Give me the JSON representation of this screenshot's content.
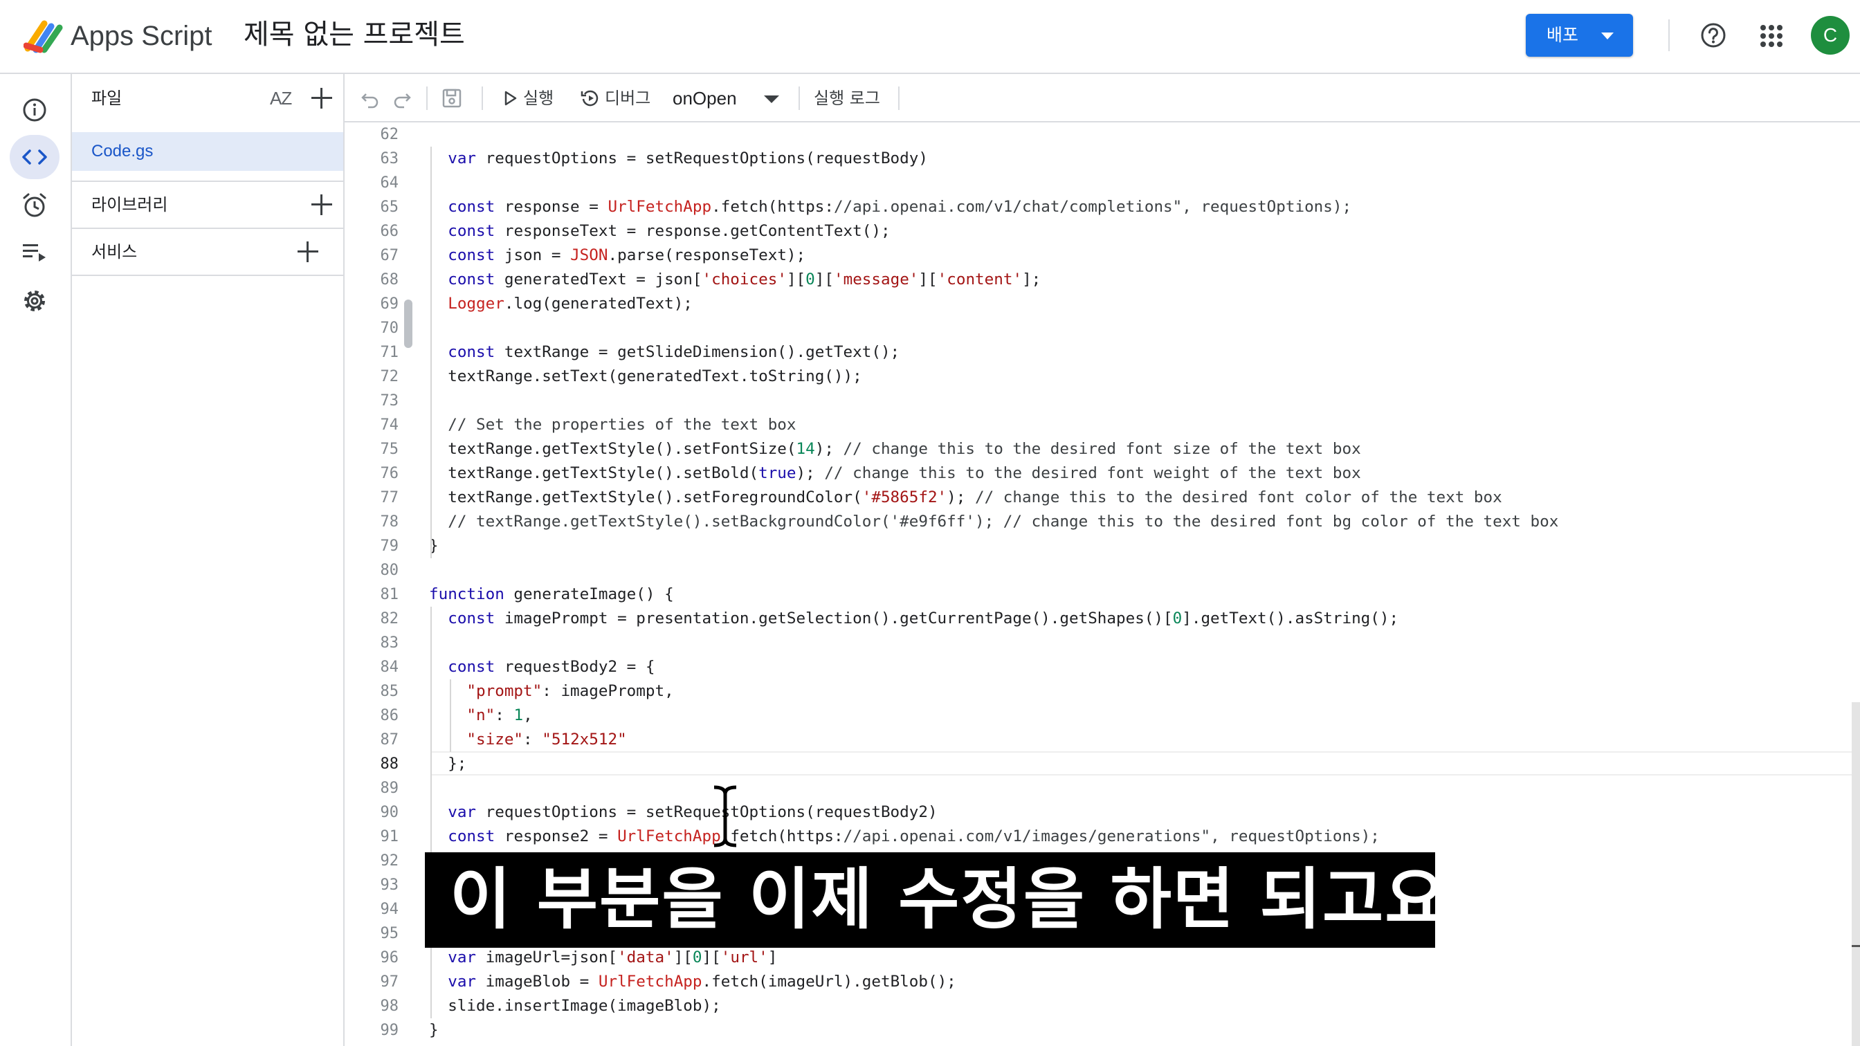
{
  "header": {
    "brand": "Apps Script",
    "project_title": "제목 없는 프로젝트",
    "deploy_label": "배포",
    "avatar_letter": "C"
  },
  "files_panel": {
    "title": "파일",
    "sort_label": "AZ",
    "file_name": "Code.gs",
    "libraries_label": "라이브러리",
    "services_label": "서비스"
  },
  "toolbar": {
    "run_label": "실행",
    "debug_label": "디버그",
    "function_name": "onOpen",
    "log_label": "실행 로그"
  },
  "editor": {
    "current_line": "88",
    "lines": [
      {
        "n": "62",
        "t": ""
      },
      {
        "n": "63",
        "t": "  var requestOptions = setRequestOptions(requestBody)"
      },
      {
        "n": "64",
        "t": ""
      },
      {
        "n": "65",
        "t": "  const response = UrlFetchApp.fetch(\"https://api.openai.com/v1/chat/completions\", requestOptions);"
      },
      {
        "n": "66",
        "t": "  const responseText = response.getContentText();"
      },
      {
        "n": "67",
        "t": "  const json = JSON.parse(responseText);"
      },
      {
        "n": "68",
        "t": "  const generatedText = json['choices'][0]['message']['content'];"
      },
      {
        "n": "69",
        "t": "  Logger.log(generatedText);"
      },
      {
        "n": "70",
        "t": ""
      },
      {
        "n": "71",
        "t": "  const textRange = getSlideDimension().getText();"
      },
      {
        "n": "72",
        "t": "  textRange.setText(generatedText.toString());"
      },
      {
        "n": "73",
        "t": ""
      },
      {
        "n": "74",
        "t": "  // Set the properties of the text box"
      },
      {
        "n": "75",
        "t": "  textRange.getTextStyle().setFontSize(14); // change this to the desired font size of the text box"
      },
      {
        "n": "76",
        "t": "  textRange.getTextStyle().setBold(true); // change this to the desired font weight of the text box"
      },
      {
        "n": "77",
        "t": "  textRange.getTextStyle().setForegroundColor('#5865f2'); // change this to the desired font color of the text box"
      },
      {
        "n": "78",
        "t": "  // textRange.getTextStyle().setBackgroundColor('#e9f6ff'); // change this to the desired font bg color of the text box"
      },
      {
        "n": "79",
        "t": "}"
      },
      {
        "n": "80",
        "t": ""
      },
      {
        "n": "81",
        "t": "function generateImage() {"
      },
      {
        "n": "82",
        "t": "  const imagePrompt = presentation.getSelection().getCurrentPage().getShapes()[0].getText().asString();"
      },
      {
        "n": "83",
        "t": ""
      },
      {
        "n": "84",
        "t": "  const requestBody2 = {"
      },
      {
        "n": "85",
        "t": "    \"prompt\": imagePrompt,"
      },
      {
        "n": "86",
        "t": "    \"n\": 1,"
      },
      {
        "n": "87",
        "t": "    \"size\": \"512x512\""
      },
      {
        "n": "88",
        "t": "  };"
      },
      {
        "n": "89",
        "t": ""
      },
      {
        "n": "90",
        "t": "  var requestOptions = setRequestOptions(requestBody2)"
      },
      {
        "n": "91",
        "t": "  const response2 = UrlFetchApp.fetch(\"https://api.openai.com/v1/images/generations\", requestOptions);"
      },
      {
        "n": "92",
        "t": ""
      },
      {
        "n": "93",
        "t": ""
      },
      {
        "n": "94",
        "t": ""
      },
      {
        "n": "95",
        "t": ""
      },
      {
        "n": "96",
        "t": "  var imageUrl=json['data'][0]['url']"
      },
      {
        "n": "97",
        "t": "  var imageBlob = UrlFetchApp.fetch(imageUrl).getBlob();"
      },
      {
        "n": "98",
        "t": "  slide.insertImage(imageBlob);"
      },
      {
        "n": "99",
        "t": "}"
      }
    ]
  },
  "caption": {
    "text": "이 부분을 이제 수정을 하면 되고요"
  },
  "colors": {
    "accent": "#1a73e8",
    "avatar_bg": "#1e8e3e",
    "active_file_bg": "#e2eaf8",
    "keyword": "#2a00ff",
    "class": "#c5221f",
    "string": "#a31515",
    "number": "#098658"
  }
}
